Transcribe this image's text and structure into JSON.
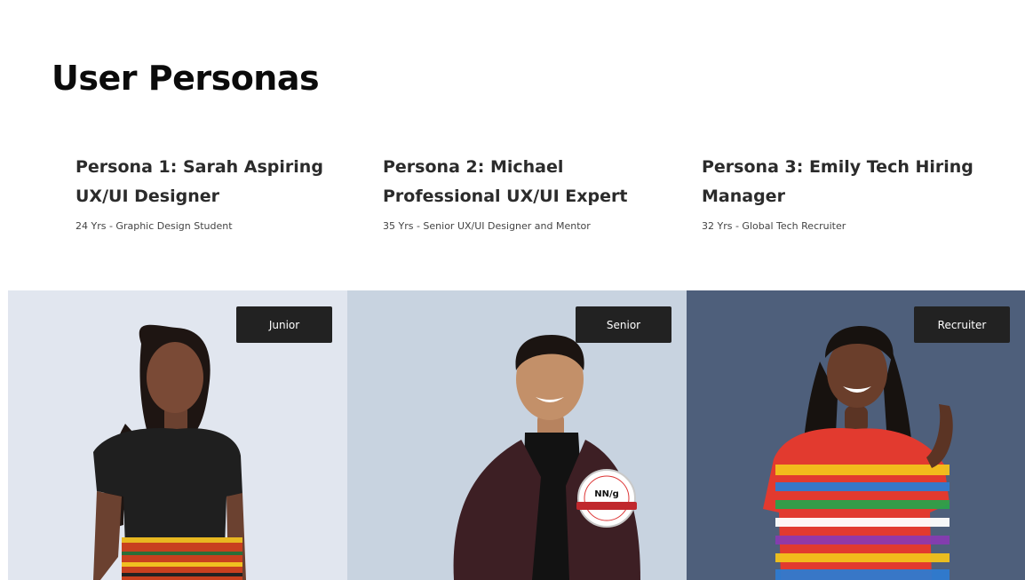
{
  "page": {
    "title": "User Personas"
  },
  "colors": {
    "panel_1_bg": "#e1e6ef",
    "panel_2_bg": "#c8d3e0",
    "panel_3_bg": "#4e5f7b",
    "badge_bg": "#222222"
  },
  "personas": [
    {
      "name_line1": "Persona 1: Sarah Aspiring",
      "name_line2": "UX/UI Designer",
      "meta": "24 Yrs - Graphic Design Student",
      "tag": "Junior"
    },
    {
      "name_line1": "Persona 2: Michael",
      "name_line2": "Professional UX/UI Expert",
      "meta": "35 Yrs - Senior UX/UI Designer and Mentor",
      "tag": "Senior",
      "seal_text": "NN/g"
    },
    {
      "name_line1": "Persona 3:  Emily Tech Hiring",
      "name_line2": "Manager",
      "meta": "32 Yrs - Global Tech Recruiter",
      "tag": "Recruiter"
    }
  ]
}
